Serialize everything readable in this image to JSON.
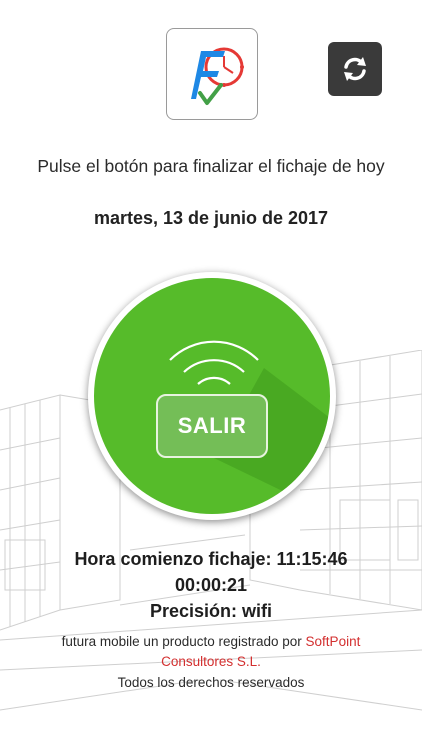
{
  "header": {
    "logo_icon": "futura-fichaje-logo",
    "refresh_icon": "refresh-icon"
  },
  "instruction": "Pulse el botón para finalizar el fichaje de hoy",
  "date": "martes, 13 de junio de 2017",
  "clock_button": {
    "label": "SALIR",
    "icon": "wifi-icon",
    "color": "#56bb2a"
  },
  "status": {
    "start_time": "Hora comienzo fichaje: 11:15:46",
    "elapsed": "00:00:21",
    "precision": "Precisión: wifi"
  },
  "footer": {
    "line1_prefix": "futura mobile un producto registrado por",
    "link_part1": "SoftPoint",
    "link_part2": "Consultores S.L.",
    "rights": "Todos los derechos reservados",
    "link_color": "#d32f2f"
  }
}
